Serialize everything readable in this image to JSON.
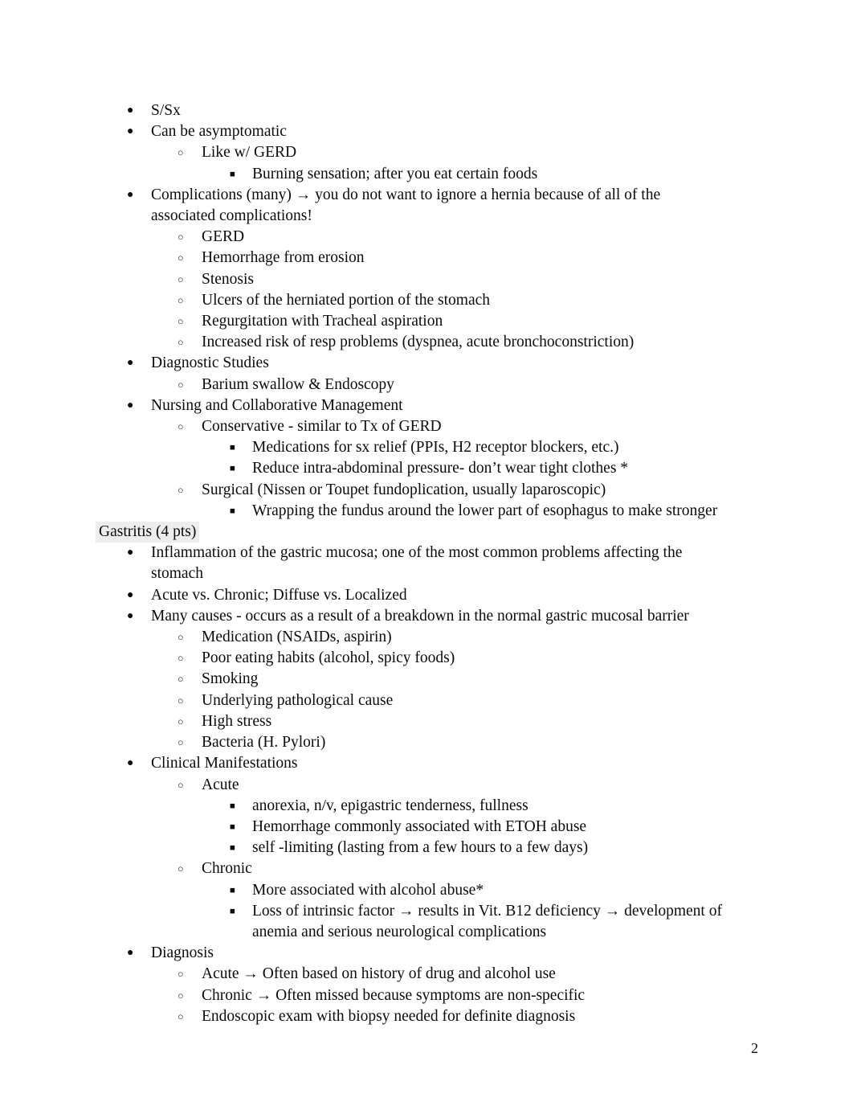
{
  "document": {
    "page_number": "2",
    "markers": {
      "level1": "●",
      "level2": "○",
      "level3": "■"
    },
    "highlight_color": "#ededed",
    "text_color": "#0b0b0b",
    "background_color": "#ffffff"
  },
  "blocks": [
    {
      "level": 1,
      "text": "S/Sx"
    },
    {
      "level": 1,
      "text": "Can be asymptomatic"
    },
    {
      "level": 2,
      "text": "Like w/ GERD"
    },
    {
      "level": 3,
      "text": "Burning sensation; after you eat certain foods"
    },
    {
      "level": 1,
      "text": "Complications (many) → you do not want to ignore a hernia because of all of the associated complications!"
    },
    {
      "level": 2,
      "text": "GERD"
    },
    {
      "level": 2,
      "text": "Hemorrhage from erosion"
    },
    {
      "level": 2,
      "text": "Stenosis"
    },
    {
      "level": 2,
      "text": "Ulcers of the herniated portion of the stomach"
    },
    {
      "level": 2,
      "text": "Regurgitation with Tracheal aspiration"
    },
    {
      "level": 2,
      "text": "Increased risk of resp problems (dyspnea, acute bronchoconstriction)"
    },
    {
      "level": 1,
      "text": "Diagnostic Studies"
    },
    {
      "level": 2,
      "text": "Barium swallow & Endoscopy"
    },
    {
      "level": 1,
      "text": "Nursing and Collaborative Management"
    },
    {
      "level": 2,
      "text": "Conservative - similar to Tx of GERD"
    },
    {
      "level": 3,
      "text": "Medications for sx relief (PPIs, H2 receptor blockers, etc.)"
    },
    {
      "level": 3,
      "text": "Reduce intra-abdominal pressure- don’t wear tight clothes *"
    },
    {
      "level": 2,
      "text": "Surgical (Nissen or Toupet fundoplication, usually laparoscopic)"
    },
    {
      "level": 3,
      "text": "Wrapping the fundus around the lower part of esophagus to make stronger"
    },
    {
      "level": 0,
      "text": "Gastritis (4 pts)",
      "highlighted": true
    },
    {
      "level": 1,
      "text": "Inflammation of the gastric mucosa; one of the most common problems affecting the stomach"
    },
    {
      "level": 1,
      "text": "Acute vs. Chronic; Diffuse vs. Localized"
    },
    {
      "level": 1,
      "text": "Many causes - occurs as a result of a breakdown in the normal gastric mucosal barrier"
    },
    {
      "level": 2,
      "text": "Medication (NSAIDs, aspirin)"
    },
    {
      "level": 2,
      "text": "Poor eating habits (alcohol, spicy foods)"
    },
    {
      "level": 2,
      "text": "Smoking"
    },
    {
      "level": 2,
      "text": "Underlying pathological cause"
    },
    {
      "level": 2,
      "text": "High stress"
    },
    {
      "level": 2,
      "text": "Bacteria (H. Pylori)"
    },
    {
      "level": 1,
      "text": "Clinical Manifestations"
    },
    {
      "level": 2,
      "text": "Acute"
    },
    {
      "level": 3,
      "text": "anorexia, n/v, epigastric tenderness, fullness"
    },
    {
      "level": 3,
      "text": "Hemorrhage commonly associated with ETOH abuse"
    },
    {
      "level": 3,
      "text": "self -limiting (lasting from a few hours to a few days)"
    },
    {
      "level": 2,
      "text": "Chronic"
    },
    {
      "level": 3,
      "text": "More associated with alcohol abuse*"
    },
    {
      "level": 3,
      "text": "Loss of intrinsic factor → results in Vit. B12 deficiency → development of anemia and serious neurological complications"
    },
    {
      "level": 1,
      "text": "Diagnosis"
    },
    {
      "level": 2,
      "text": "Acute → Often based on history of drug and alcohol use"
    },
    {
      "level": 2,
      "text": "Chronic → Often missed because symptoms are non-specific"
    },
    {
      "level": 2,
      "text": "Endoscopic exam with biopsy needed for definite diagnosis"
    }
  ]
}
